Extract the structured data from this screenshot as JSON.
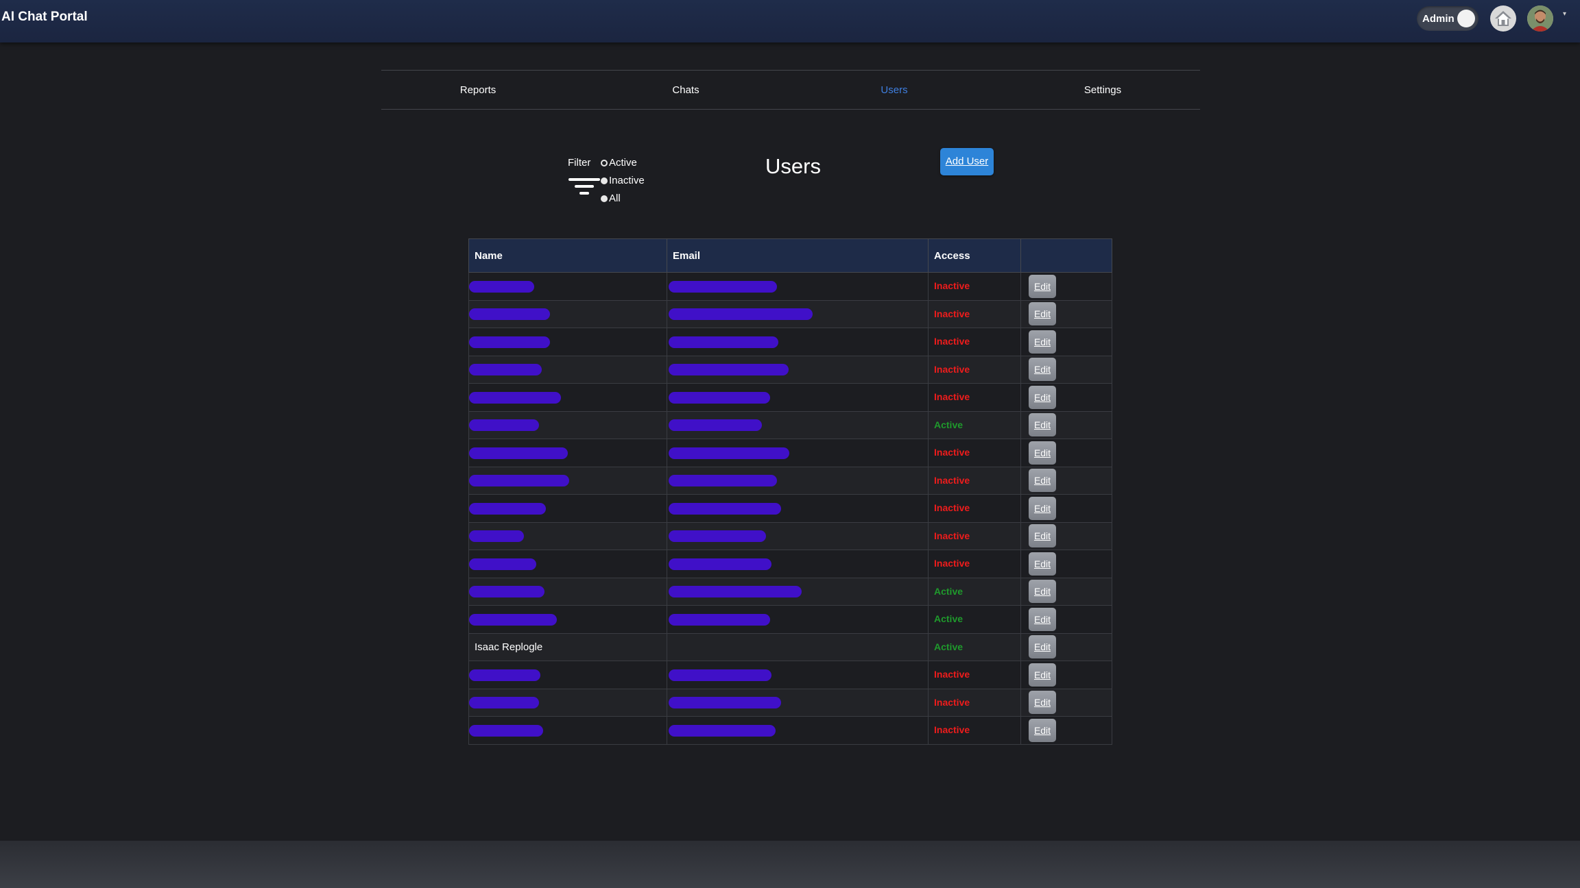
{
  "header": {
    "app_title": "AI Chat Portal",
    "admin_label": "Admin",
    "icons": [
      "home-icon",
      "user-avatar-icon",
      "chevron-down-icon"
    ]
  },
  "nav": {
    "tabs": [
      {
        "label": "Reports",
        "active": false
      },
      {
        "label": "Chats",
        "active": false
      },
      {
        "label": "Users",
        "active": true
      },
      {
        "label": "Settings",
        "active": false
      }
    ]
  },
  "filter": {
    "label": "Filter",
    "icon": "filter-lines-icon",
    "options": [
      {
        "label": "Active",
        "selected": false
      },
      {
        "label": "Inactive",
        "selected": true
      },
      {
        "label": "All",
        "selected": false
      }
    ]
  },
  "page_title": "Users",
  "add_user_label": "Add User",
  "table": {
    "columns": [
      "Name",
      "Email",
      "Access",
      ""
    ],
    "edit_label": "Edit",
    "rows": [
      {
        "name": "",
        "email": "",
        "access": "Inactive"
      },
      {
        "name": "",
        "email": "",
        "access": "Inactive"
      },
      {
        "name": "",
        "email": "",
        "access": "Inactive"
      },
      {
        "name": "",
        "email": "",
        "access": "Inactive"
      },
      {
        "name": "",
        "email": "",
        "access": "Inactive"
      },
      {
        "name": "",
        "email": "",
        "access": "Active"
      },
      {
        "name": "",
        "email": "",
        "access": "Inactive"
      },
      {
        "name": "",
        "email": "",
        "access": "Inactive"
      },
      {
        "name": "",
        "email": "",
        "access": "Inactive"
      },
      {
        "name": "",
        "email": "",
        "access": "Inactive"
      },
      {
        "name": "",
        "email": "",
        "access": "Inactive"
      },
      {
        "name": "",
        "email": "",
        "access": "Active"
      },
      {
        "name": "",
        "email": "",
        "access": "Active"
      },
      {
        "name": "Isaac Replogle",
        "email": "",
        "access": "Active"
      },
      {
        "name": "",
        "email": "",
        "access": "Inactive"
      },
      {
        "name": "",
        "email": "",
        "access": "Inactive"
      },
      {
        "name": "",
        "email": "",
        "access": "Inactive"
      }
    ]
  },
  "colors": {
    "header_bg": "#1e2b48",
    "active_tab": "#3f7fe0",
    "inactive": "#ee1c1c",
    "active": "#1f9a2c",
    "add_button": "#2d84d8",
    "redaction": "#4010c8"
  }
}
